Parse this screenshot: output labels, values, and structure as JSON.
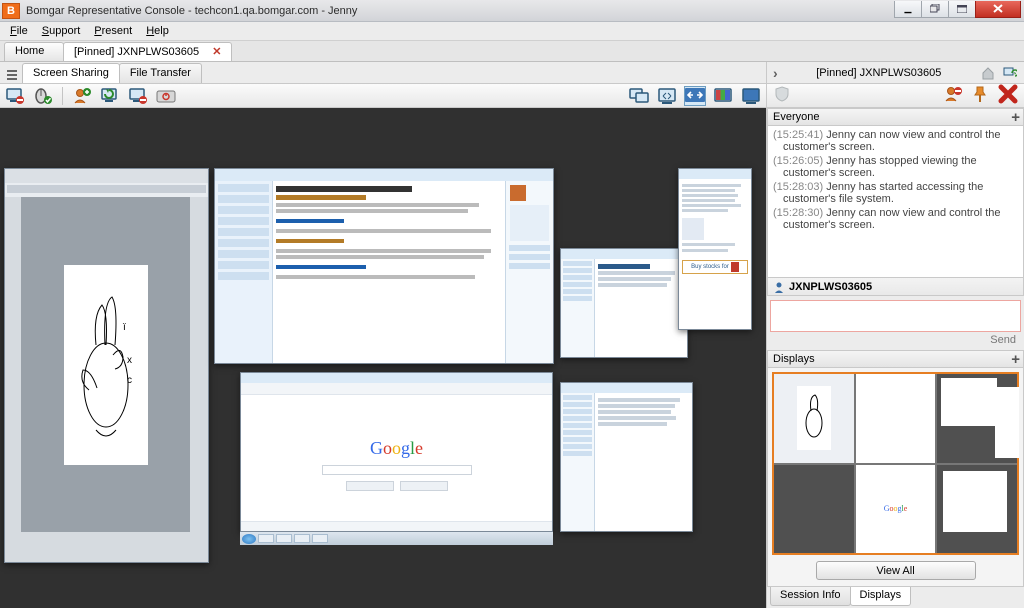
{
  "title": "Bomgar Representative Console - techcon1.qa.bomgar.com - Jenny",
  "menu": {
    "file": "File",
    "support": "Support",
    "present": "Present",
    "help": "Help"
  },
  "doctabs": {
    "home": "Home",
    "pinned": "[Pinned] JXNPLWS03605"
  },
  "subtabs": {
    "screen": "Screen Sharing",
    "file": "File Transfer"
  },
  "session": {
    "label": "[Pinned] JXNPLWS03605"
  },
  "chat": {
    "header": "Everyone",
    "lines": [
      {
        "ts": "(15:25:41)",
        "msg": "Jenny can now view and control the customer's screen."
      },
      {
        "ts": "(15:26:05)",
        "msg": "Jenny has stopped viewing the customer's screen."
      },
      {
        "ts": "(15:28:03)",
        "msg": "Jenny has started accessing the customer's file system."
      },
      {
        "ts": "(15:28:30)",
        "msg": "Jenny can now view and control the customer's screen."
      }
    ],
    "customer": "JXNPLWS03605",
    "send": "Send"
  },
  "displays": {
    "header": "Displays",
    "viewall": "View All"
  },
  "bottomtabs": {
    "info": "Session Info",
    "disp": "Displays"
  }
}
